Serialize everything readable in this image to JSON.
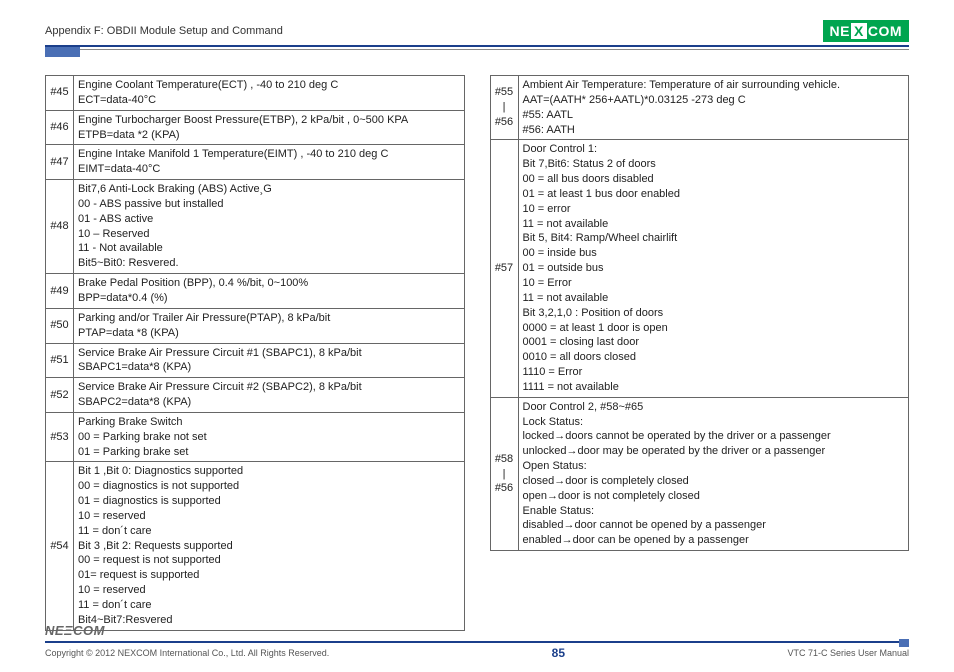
{
  "header": {
    "title": "Appendix F: OBDII Module Setup and Command",
    "logo_parts": [
      "NE",
      "X",
      "COM"
    ]
  },
  "left_rows": [
    {
      "id": "#45",
      "text": "Engine Coolant Temperature(ECT) , -40 to 210 deg C\nECT=data-40°C"
    },
    {
      "id": "#46",
      "text": "Engine Turbocharger Boost Pressure(ETBP), 2 kPa/bit , 0~500 KPA\nETPB=data *2 (KPA)"
    },
    {
      "id": "#47",
      "text": "Engine Intake Manifold 1 Temperature(EIMT) , -40 to 210 deg C\nEIMT=data-40°C"
    },
    {
      "id": "#48",
      "text": "Bit7,6 Anti-Lock Braking (ABS) Active¸G\n00 - ABS passive but installed\n01 - ABS active\n10 – Reserved\n11 - Not available\nBit5~Bit0: Resvered."
    },
    {
      "id": "#49",
      "text": "Brake Pedal Position (BPP), 0.4 %/bit, 0~100%\nBPP=data*0.4 (%)"
    },
    {
      "id": "#50",
      "text": "Parking and/or Trailer Air Pressure(PTAP), 8 kPa/bit\nPTAP=data *8 (KPA)"
    },
    {
      "id": "#51",
      "text": "Service Brake Air Pressure Circuit #1 (SBAPC1), 8 kPa/bit\nSBAPC1=data*8 (KPA)"
    },
    {
      "id": "#52",
      "text": "Service Brake Air Pressure Circuit #2 (SBAPC2), 8 kPa/bit\nSBAPC2=data*8 (KPA)"
    },
    {
      "id": "#53",
      "text": "Parking Brake Switch\n00 = Parking brake not set\n01 = Parking brake set"
    },
    {
      "id": "#54",
      "text": "Bit 1 ,Bit 0: Diagnostics supported\n00 = diagnostics is not supported\n01 = diagnostics is supported\n10 = reserved\n11 = don´t care\nBit 3 ,Bit 2: Requests supported\n00 = request is not supported\n01= request is supported\n10 = reserved\n11 = don´t care\nBit4~Bit7:Resvered"
    }
  ],
  "right_rows": [
    {
      "id": "#55\n|\n#56",
      "text": "Ambient Air Temperature: Temperature of air surrounding vehicle.\nAAT=(AATH* 256+AATL)*0.03125 -273 deg C\n#55: AATL\n#56: AATH"
    },
    {
      "id": "#57",
      "text": "Door Control 1:\nBit 7,Bit6: Status 2 of doors\n00 = all bus doors disabled\n01 = at least 1 bus door enabled\n10 = error\n11 = not available\nBit 5, Bit4: Ramp/Wheel chairlift\n00 = inside bus\n01 = outside bus\n10 = Error\n11 = not available\nBit 3,2,1,0 : Position of doors\n0000 = at least 1 door is open\n0001 = closing last door\n0010 = all doors closed\n1110 = Error\n1111 = not available"
    },
    {
      "id": "#58\n|\n#56",
      "text": "Door Control 2, #58~#65\nLock Status:\nlocked→doors cannot be operated by the driver or a passenger\nunlocked→door may be operated by the driver or a passenger\nOpen Status:\nclosed→door is completely closed\nopen→door is not completely closed\nEnable Status:\ndisabled→door cannot be opened by a passenger\nenabled→door can be opened by a passenger"
    }
  ],
  "footer": {
    "logo": "NE‍ΞCOM",
    "copyright": "Copyright © 2012 NEXCOM International Co., Ltd. All Rights Reserved.",
    "page": "85",
    "manual": "VTC 71-C Series User Manual"
  }
}
